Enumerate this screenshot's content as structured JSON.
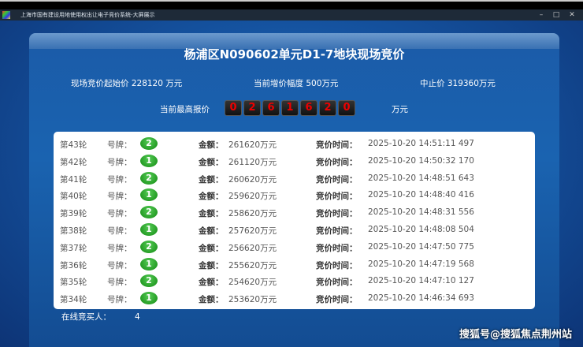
{
  "window": {
    "title": "上海市国有建设用地使用权出让电子竞价系统-大屏展示",
    "minimize": "–",
    "maximize": "□",
    "close": "✕"
  },
  "header": {
    "title": "杨浦区N090602单元D1-7地块现场竞价"
  },
  "info": {
    "start_price": "现场竞价起始价 228120 万元",
    "increment": "当前增价幅度 500万元",
    "stop_price": "中止价 319360万元"
  },
  "highest": {
    "label": "当前最高报价",
    "digits": [
      "0",
      "2",
      "6",
      "1",
      "6",
      "2",
      "0"
    ],
    "unit": "万元"
  },
  "labels": {
    "plate": "号牌：",
    "amount": "金额：",
    "time": "竞价时间："
  },
  "rows": [
    {
      "round": "第43轮",
      "plate": "2",
      "amount": "261620万元",
      "time": "2025-10-20 14:51:11 497"
    },
    {
      "round": "第42轮",
      "plate": "1",
      "amount": "261120万元",
      "time": "2025-10-20 14:50:32 170"
    },
    {
      "round": "第41轮",
      "plate": "2",
      "amount": "260620万元",
      "time": "2025-10-20 14:48:51 643"
    },
    {
      "round": "第40轮",
      "plate": "1",
      "amount": "259620万元",
      "time": "2025-10-20 14:48:40 416"
    },
    {
      "round": "第39轮",
      "plate": "2",
      "amount": "258620万元",
      "time": "2025-10-20 14:48:31 556"
    },
    {
      "round": "第38轮",
      "plate": "1",
      "amount": "257620万元",
      "time": "2025-10-20 14:48:08 504"
    },
    {
      "round": "第37轮",
      "plate": "2",
      "amount": "256620万元",
      "time": "2025-10-20 14:47:50 775"
    },
    {
      "round": "第36轮",
      "plate": "1",
      "amount": "255620万元",
      "time": "2025-10-20 14:47:19 568"
    },
    {
      "round": "第35轮",
      "plate": "2",
      "amount": "254620万元",
      "time": "2025-10-20 14:47:10 127"
    },
    {
      "round": "第34轮",
      "plate": "1",
      "amount": "253620万元",
      "time": "2025-10-20 14:46:34 693"
    }
  ],
  "online": {
    "label": "在线竞买人：",
    "count": "4"
  },
  "watermark": "搜狐号@搜狐焦点荆州站"
}
